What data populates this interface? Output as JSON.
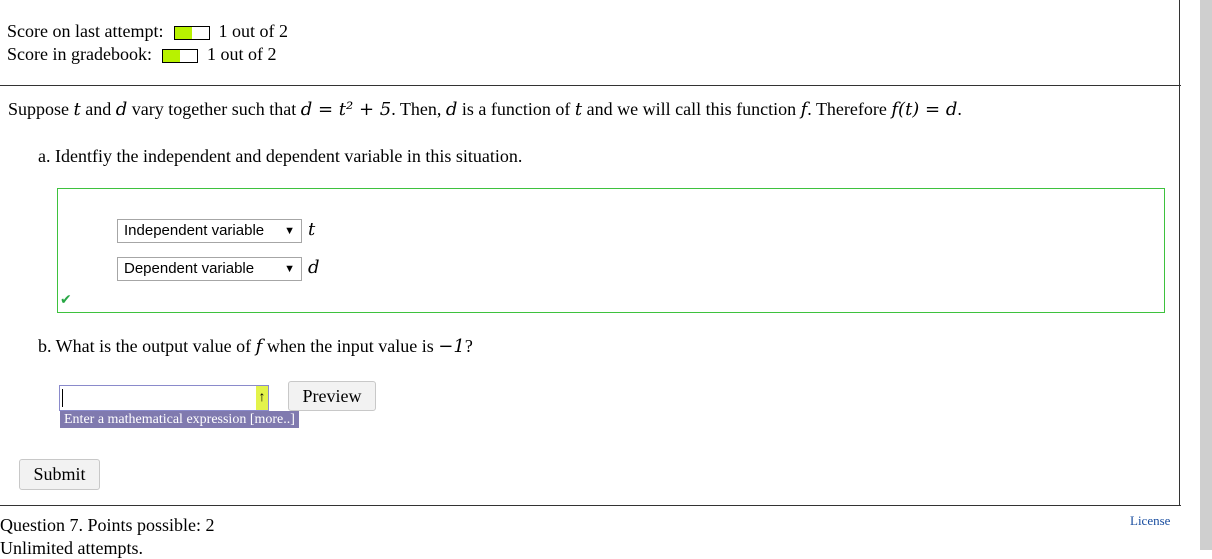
{
  "score": {
    "last_attempt_label": "Score on last attempt:",
    "last_attempt_value": "1 out of 2",
    "last_attempt_fraction": 0.5,
    "gradebook_label": "Score in gradebook:",
    "gradebook_value": "1 out of 2",
    "gradebook_fraction": 0.5,
    "bar_color": "#b8f200"
  },
  "question": {
    "intro_1": "Suppose ",
    "var_t": "t",
    "intro_2": " and ",
    "var_d": "d",
    "intro_3": " vary together such that ",
    "equation": "d = t² + 5",
    "intro_4": ". Then, ",
    "intro_5": " is a function of ",
    "intro_6": " and we will call this function ",
    "var_f": "f",
    "intro_7": ". Therefore ",
    "relation": "f(t) = d",
    "intro_end": "."
  },
  "part_a": {
    "prompt": "a. Identfiy the independent and dependent variable in this situation.",
    "rows": [
      {
        "selected": "Independent variable",
        "variable": "t"
      },
      {
        "selected": "Dependent variable",
        "variable": "d"
      }
    ],
    "correct_icon": "checkmark-icon"
  },
  "part_b": {
    "prompt_1": "b. What is the output value of ",
    "var_f": "f",
    "prompt_2": " when the input value is ",
    "input_value": "−1",
    "prompt_end": "?",
    "input_value_current": "",
    "preview_label": "Preview",
    "hint": "Enter a mathematical expression [more..]"
  },
  "submit_label": "Submit",
  "next_question": {
    "title": "Question 7. Points possible: 2",
    "attempts": "Unlimited attempts."
  },
  "license_label": "License",
  "colors": {
    "correct": "#3ec23e",
    "hint_bg": "#807aaf",
    "link": "#1a4ea0"
  }
}
